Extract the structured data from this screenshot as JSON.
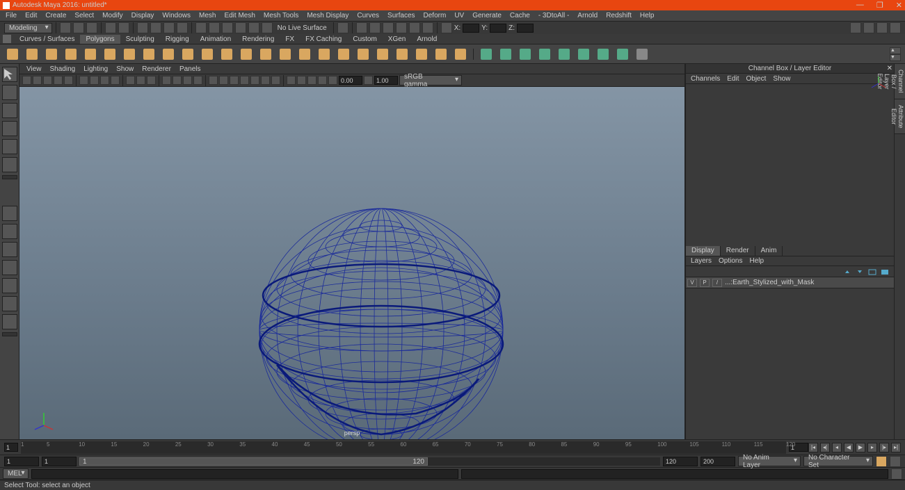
{
  "title": "Autodesk Maya 2016: untitled*",
  "mainMenu": [
    "File",
    "Edit",
    "Create",
    "Select",
    "Modify",
    "Display",
    "Windows",
    "Mesh",
    "Edit Mesh",
    "Mesh Tools",
    "Mesh Display",
    "Curves",
    "Surfaces",
    "Deform",
    "UV",
    "Generate",
    "Cache",
    "- 3DtoAll -",
    "Arnold",
    "Redshift",
    "Help"
  ],
  "moduleSelector": "Modeling",
  "noLiveSurface": "No Live Surface",
  "xyz": {
    "x": "X:",
    "y": "Y:",
    "z": "Z:"
  },
  "shelfTabs": [
    "Curves / Surfaces",
    "Polygons",
    "Sculpting",
    "Rigging",
    "Animation",
    "Rendering",
    "FX",
    "FX Caching",
    "Custom",
    "XGen",
    "Arnold"
  ],
  "activeShelf": 1,
  "panelMenu": [
    "View",
    "Shading",
    "Lighting",
    "Show",
    "Renderer",
    "Panels"
  ],
  "exposure": "0.00",
  "gamma": "1.00",
  "colorspace": "sRGB gamma",
  "cameraLabel": "persp",
  "channelBox": {
    "title": "Channel Box / Layer Editor",
    "menu": [
      "Channels",
      "Edit",
      "Object",
      "Show"
    ]
  },
  "layerTabs": [
    "Display",
    "Render",
    "Anim"
  ],
  "activeLayerTab": 0,
  "layerMenu": [
    "Layers",
    "Options",
    "Help"
  ],
  "layer": {
    "v": "V",
    "p": "P",
    "name": "...:Earth_Stylized_with_Mask"
  },
  "verticalTabs": [
    "Channel Box / Layer Editor",
    "Attribute Editor"
  ],
  "timeline": {
    "start": 1,
    "end": 120,
    "ticks": [
      1,
      5,
      10,
      15,
      20,
      25,
      30,
      35,
      40,
      45,
      50,
      55,
      60,
      65,
      70,
      75,
      80,
      85,
      90,
      95,
      100,
      105,
      110,
      115,
      120
    ]
  },
  "range": {
    "startOuter": "1",
    "startInner": "1",
    "display": "1",
    "endInner": "120",
    "endOuter": "120",
    "rangeEnd": "200"
  },
  "animLayer": "No Anim Layer",
  "charSet": "No Character Set",
  "cmdLabel": "MEL",
  "helpText": "Select Tool: select an object"
}
